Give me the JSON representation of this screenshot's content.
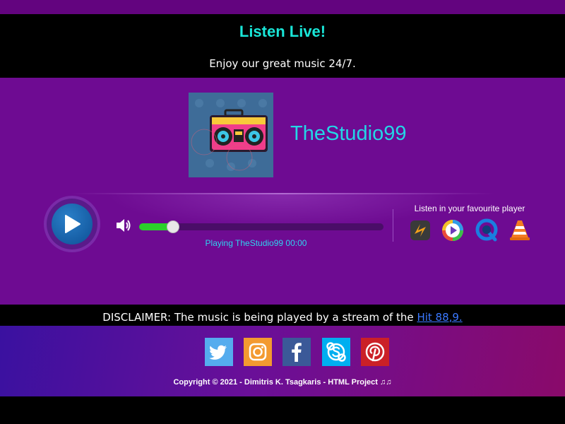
{
  "header": {
    "title": "Listen Live!",
    "subtitle": "Enjoy our great music 24/7."
  },
  "station": {
    "name": "TheStudio99",
    "cover_icon": "boombox-image"
  },
  "player": {
    "play_icon": "play-icon",
    "volume_icon": "speaker-icon",
    "progress": 0.14,
    "status_text": "Playing TheStudio99 00:00",
    "favourite_label": "Listen in your favourite player",
    "players": [
      {
        "name": "winamp-icon"
      },
      {
        "name": "windows-media-player-icon"
      },
      {
        "name": "quicktime-icon"
      },
      {
        "name": "vlc-icon"
      }
    ]
  },
  "disclaimer": {
    "text": "DISCLAIMER: The music is being played by a stream of the ",
    "link": "Hit 88,9."
  },
  "footer": {
    "social": [
      {
        "name": "twitter-icon",
        "color": "#55acee"
      },
      {
        "name": "instagram-icon",
        "color": "#f39a30"
      },
      {
        "name": "facebook-icon",
        "color": "#3b5998"
      },
      {
        "name": "skype-icon",
        "color": "#00aff0"
      },
      {
        "name": "pinterest-icon",
        "color": "#cb2027"
      }
    ],
    "copyright": "Copyright © 2021 - Dimitris K. Tsagkaris - HTML Project ♫♫"
  },
  "colors": {
    "accent": "#19e6d8",
    "background": "#6e0b92",
    "progress": "#2bd12b"
  }
}
